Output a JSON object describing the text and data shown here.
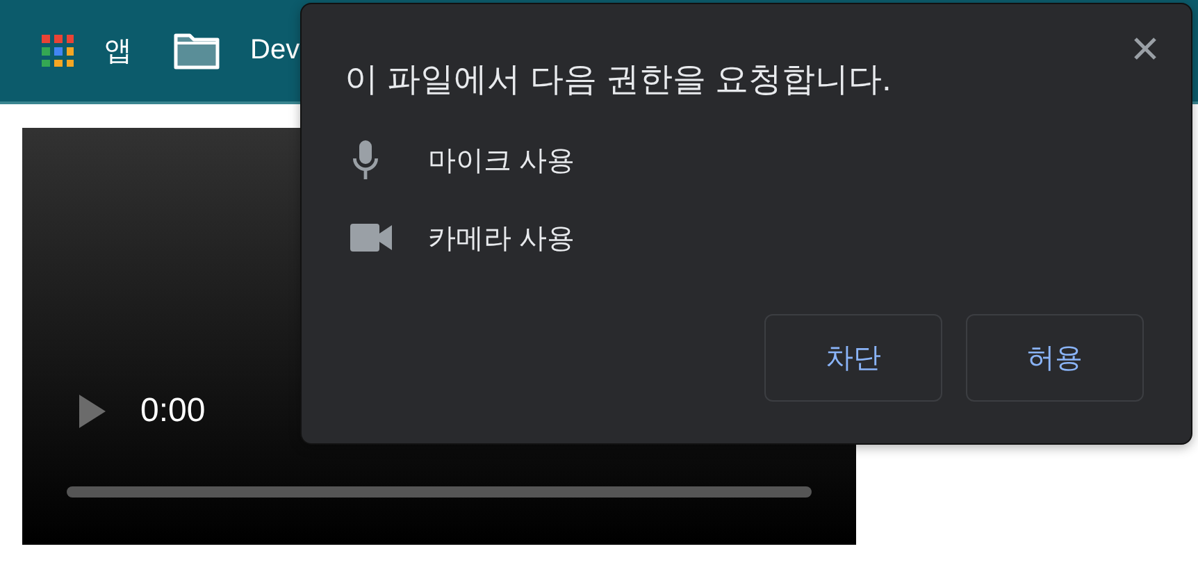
{
  "bookmarks_bar": {
    "items": [
      {
        "kind": "apps",
        "label": "앱"
      },
      {
        "kind": "folder",
        "label": "Dev"
      }
    ]
  },
  "video": {
    "time": "0:00"
  },
  "permission_dialog": {
    "title": "이 파일에서 다음 권한을 요청합니다.",
    "permissions": [
      {
        "kind": "microphone",
        "label": "마이크 사용"
      },
      {
        "kind": "camera",
        "label": "카메라 사용"
      }
    ],
    "buttons": [
      "차단",
      "허용"
    ]
  }
}
